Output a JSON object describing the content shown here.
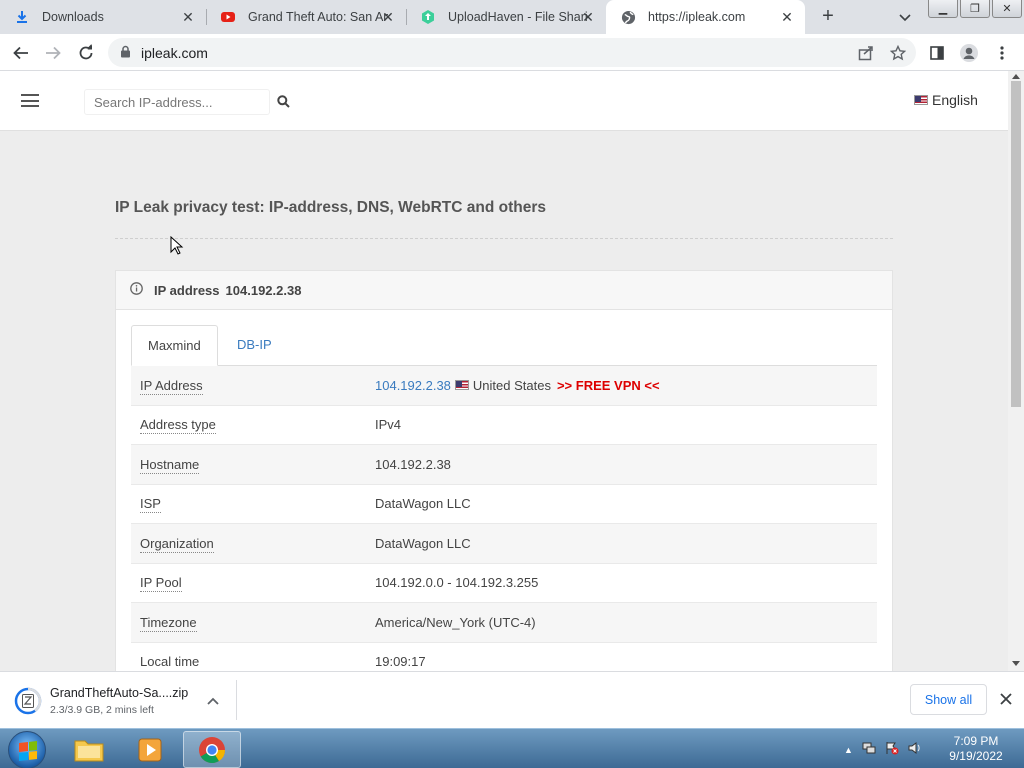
{
  "browser": {
    "tabs": [
      {
        "title": "Downloads",
        "icon": "download-icon"
      },
      {
        "title": "Grand Theft Auto: San Andreas",
        "icon": "youtube-icon"
      },
      {
        "title": "UploadHaven - File Sharing",
        "icon": "uploadhaven-icon"
      },
      {
        "title": "https://ipleak.com",
        "icon": "globe-icon"
      }
    ],
    "new_tab_symbol": "+",
    "url": "ipleak.com"
  },
  "site": {
    "search_placeholder": "Search IP-address...",
    "language": "English",
    "page_title": "IP Leak privacy test: IP-address, DNS, WebRTC and others",
    "panel_heading_label": "IP address",
    "panel_heading_ip": "104.192.2.38",
    "tabs": [
      {
        "label": "Maxmind"
      },
      {
        "label": "DB-IP"
      }
    ],
    "rows": [
      {
        "label": "IP Address",
        "ip": "104.192.2.38",
        "country": "United States",
        "promo": ">> FREE VPN <<"
      },
      {
        "label": "Address type",
        "value": "IPv4"
      },
      {
        "label": "Hostname",
        "value": "104.192.2.38"
      },
      {
        "label": "ISP",
        "value": "DataWagon LLC"
      },
      {
        "label": "Organization",
        "value": "DataWagon LLC"
      },
      {
        "label": "IP Pool",
        "value": "104.192.0.0 - 104.192.3.255"
      },
      {
        "label": "Timezone",
        "value": "America/New_York (UTC-4)"
      },
      {
        "label": "Local time",
        "value": "19:09:17"
      }
    ]
  },
  "download_bar": {
    "file_name": "GrandTheftAuto-Sa....zip",
    "status": "2.3/3.9 GB, 2 mins left",
    "show_all_label": "Show all"
  },
  "taskbar": {
    "time": "7:09 PM",
    "date": "9/19/2022"
  },
  "colors": {
    "link_blue": "#3a7bbf",
    "vpn_red": "#dd0000",
    "chrome_tab_bg": "#dee1e6"
  }
}
